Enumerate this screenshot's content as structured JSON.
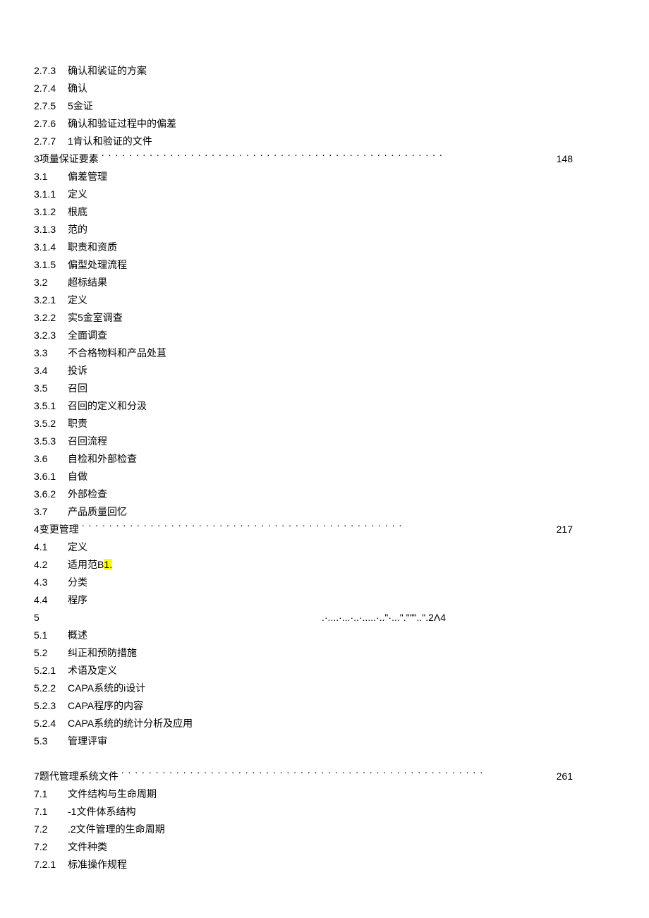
{
  "toc": [
    {
      "type": "line",
      "num": "2.7.3",
      "title": "确认和裟证的方案"
    },
    {
      "type": "line",
      "num": "2.7.4",
      "title": "确认"
    },
    {
      "type": "line",
      "num": "2.7.5",
      "title": "5金证"
    },
    {
      "type": "line",
      "num": "2.7.6",
      "title": "确认和验证过程中的偏差"
    },
    {
      "type": "line",
      "num": "2.7.7",
      "title": "1肯认和验证的文件"
    },
    {
      "type": "leader",
      "left": "3项量保证要素",
      "page": "148"
    },
    {
      "type": "line",
      "num": "3.1",
      "title": "偏差管理"
    },
    {
      "type": "line",
      "num": "3.1.1",
      "title": "定义"
    },
    {
      "type": "line",
      "num": "3.1.2",
      "title": "根底"
    },
    {
      "type": "line",
      "num": "3.1.3",
      "title": "范的"
    },
    {
      "type": "line",
      "num": "3.1.4",
      "title": "职责和资质"
    },
    {
      "type": "line",
      "num": "3.1.5",
      "title": "偏型处理流程"
    },
    {
      "type": "line",
      "num": "3.2",
      "title": "超标结果"
    },
    {
      "type": "line",
      "num": "3.2.1",
      "title": "定义"
    },
    {
      "type": "line",
      "num": "3.2.2",
      "title": "实5金室调查"
    },
    {
      "type": "line",
      "num": "3.2.3",
      "title": "全面调查"
    },
    {
      "type": "line",
      "num": "3.3",
      "title": "不合格物料和产品处苴"
    },
    {
      "type": "line",
      "num": "3.4",
      "title": "投诉"
    },
    {
      "type": "line",
      "num": "3.5",
      "title": "召回"
    },
    {
      "type": "line",
      "num": "3.5.1",
      "title": "召回的定义和分汲"
    },
    {
      "type": "line",
      "num": "3.5.2",
      "title": "职责"
    },
    {
      "type": "line",
      "num": "3.5.3",
      "title": "召回流程"
    },
    {
      "type": "line",
      "num": "3.6",
      "title": "自检和外部检查"
    },
    {
      "type": "line",
      "num": "3.6.1",
      "title": "自做"
    },
    {
      "type": "line",
      "num": "3.6.2",
      "title": "外部检查"
    },
    {
      "type": "line",
      "num": "3.7",
      "title": "产品质量回忆"
    },
    {
      "type": "leader",
      "left": "4变更管理",
      "page": "217"
    },
    {
      "type": "line",
      "num": "4.1",
      "title": "定义"
    },
    {
      "type": "hlline",
      "num": "4.2",
      "prefix": "适用范B",
      "hl": "1."
    },
    {
      "type": "line",
      "num": "4.3",
      "title": "分类"
    },
    {
      "type": "line",
      "num": "4.4",
      "title": "程序"
    },
    {
      "type": "weird",
      "num": "5",
      "right": ".·....·...·..·.....·..\"·...\".\"\"\"..\".2Λ4"
    },
    {
      "type": "line",
      "num": "5.1",
      "title": "概述"
    },
    {
      "type": "line",
      "num": "5.2",
      "title": "纠正和预防措施"
    },
    {
      "type": "line",
      "num": "5.2.1",
      "title": "术语及定义"
    },
    {
      "type": "line",
      "num": "5.2.2",
      "title": "CAPA系统的i设计"
    },
    {
      "type": "line",
      "num": "5.2.3",
      "title": "CAPA程序的内容"
    },
    {
      "type": "line",
      "num": "5.2.4",
      "title": "CAPA系统的统计分析及应用"
    },
    {
      "type": "line",
      "num": "5.3",
      "title": "管理评审"
    },
    {
      "type": "blank"
    },
    {
      "type": "leader",
      "left": "7题代管理系统文件",
      "page": "261"
    },
    {
      "type": "line",
      "num": "7.1",
      "title": "文件结构与生命周期"
    },
    {
      "type": "line",
      "num": "7.1",
      "title": "-1文件体系结构"
    },
    {
      "type": "line",
      "num": "7.2",
      "title": ".2文件管理的生命周期"
    },
    {
      "type": "line",
      "num": "7.2",
      "title": "文件种类"
    },
    {
      "type": "line",
      "num": "7.2.1",
      "title": "标准操作规程"
    }
  ]
}
